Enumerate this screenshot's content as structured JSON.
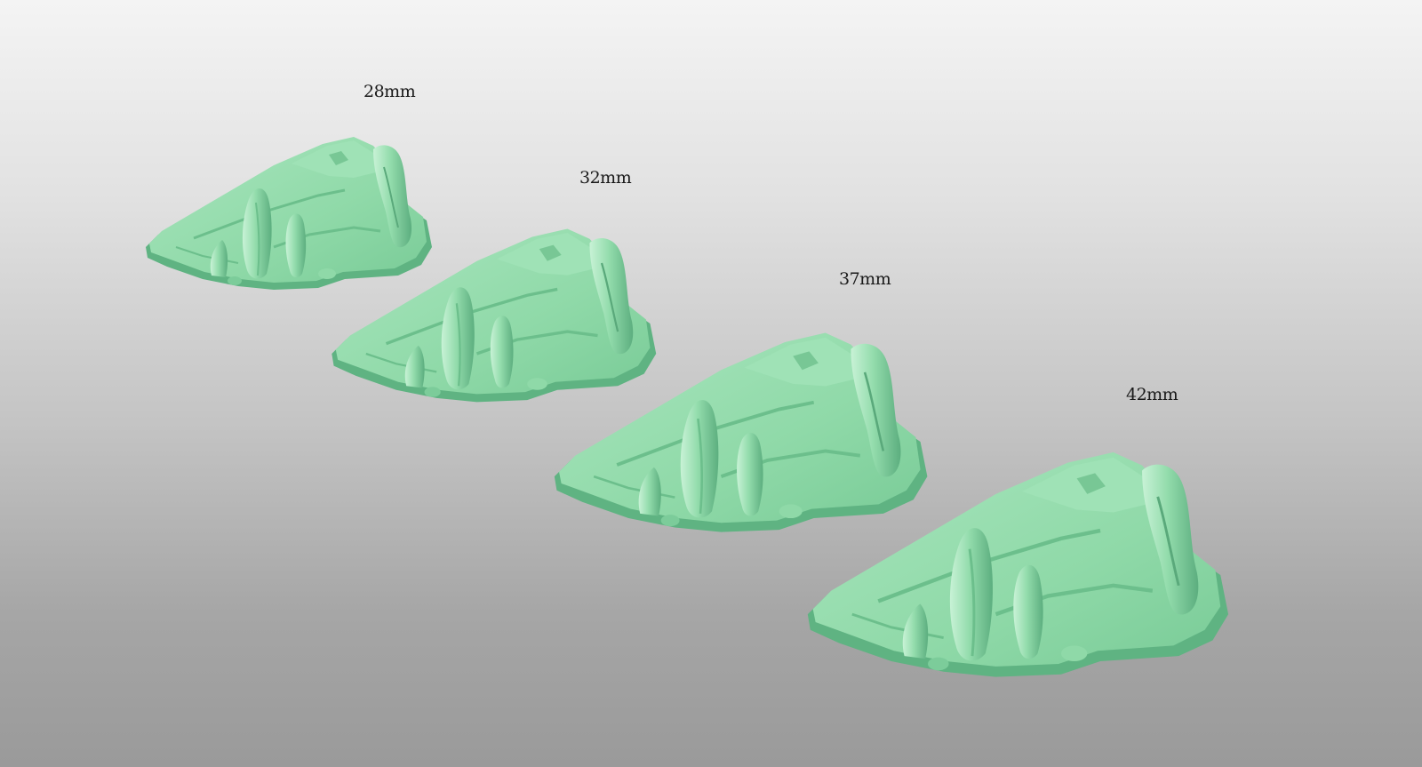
{
  "scene": {
    "models": [
      {
        "id": "base-28",
        "label": "28mm"
      },
      {
        "id": "base-32",
        "label": "32mm"
      },
      {
        "id": "base-37",
        "label": "37mm"
      },
      {
        "id": "base-42",
        "label": "42mm"
      }
    ],
    "colors": {
      "model_fill": "#86d6a4",
      "model_shadow": "#4fa876",
      "model_highlight": "#c8f2d6",
      "label_text": "#1a1a1a"
    }
  }
}
